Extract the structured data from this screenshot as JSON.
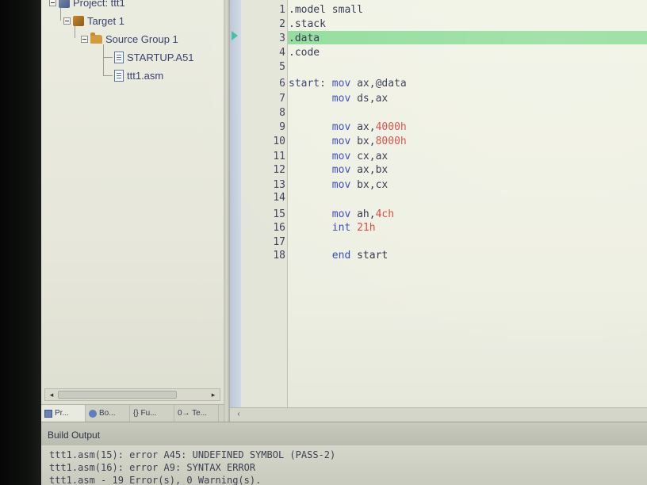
{
  "project_panel": {
    "tree": {
      "project": "Project: ttt1",
      "target": "Target 1",
      "group": "Source Group 1",
      "files": [
        "STARTUP.A51",
        "ttt1.asm"
      ]
    },
    "tabs": [
      "Pr...",
      "Bo...",
      "{} Fu...",
      "0→ Te..."
    ]
  },
  "editor": {
    "highlighted_line": 3,
    "lines": [
      {
        "n": "1",
        "code": ".model small"
      },
      {
        "n": "2",
        "code": ".stack"
      },
      {
        "n": "3",
        "code": ".data"
      },
      {
        "n": "4",
        "code": ".code"
      },
      {
        "n": "5",
        "code": ""
      },
      {
        "n": "6",
        "label": "start:",
        "kw": "mov",
        "args": "ax,@data"
      },
      {
        "n": "7",
        "kw": "mov",
        "args": "ds,ax"
      },
      {
        "n": "8",
        "code": ""
      },
      {
        "n": "9",
        "kw": "mov",
        "args": "ax,",
        "num": "4000h"
      },
      {
        "n": "10",
        "kw": "mov",
        "args": "bx,",
        "num": "8000h"
      },
      {
        "n": "11",
        "kw": "mov",
        "args": "cx,ax"
      },
      {
        "n": "12",
        "kw": "mov",
        "args": "ax,bx"
      },
      {
        "n": "13",
        "kw": "mov",
        "args": "bx,cx"
      },
      {
        "n": "14",
        "code": ""
      },
      {
        "n": "15",
        "kw": "mov",
        "args": "ah,",
        "num": "4ch"
      },
      {
        "n": "16",
        "kw": "int",
        "args": "",
        "num": "21h"
      },
      {
        "n": "17",
        "code": ""
      },
      {
        "n": "18",
        "kw": "end",
        "args": "start"
      }
    ]
  },
  "build_output": {
    "title": "Build Output",
    "lines": [
      "ttt1.asm(15): error A45: UNDEFINED SYMBOL (PASS-2)",
      "ttt1.asm(16): error A9: SYNTAX ERROR",
      "ttt1.asm - 19 Error(s), 0 Warning(s)."
    ]
  },
  "colors": {
    "keyword": "#3343b8",
    "number": "#d2453c",
    "highlight": "#8fdc9a"
  }
}
